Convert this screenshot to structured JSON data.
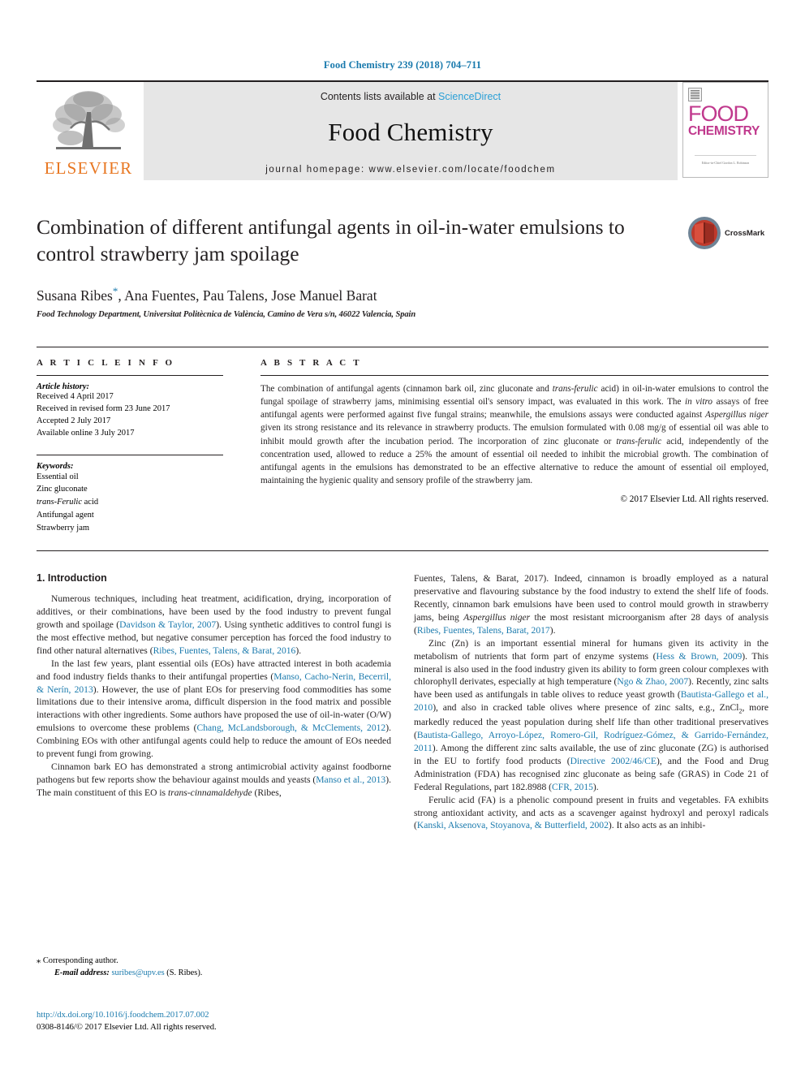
{
  "running_head": "Food Chemistry 239 (2018) 704–711",
  "masthead": {
    "publisher_name": "ELSEVIER",
    "contents_prefix": "Contents lists available at ",
    "sciencedirect": "ScienceDirect",
    "journal_title": "Food Chemistry",
    "homepage": "journal homepage: www.elsevier.com/locate/foodchem",
    "cover": {
      "food": "FOOD",
      "chemistry": "CHEMISTRY",
      "footline": "Editor-in-Chief\nGordon L. Robinson"
    }
  },
  "title": "Combination of different antifungal agents in oil-in-water emulsions to control strawberry jam spoilage",
  "authors": "Susana Ribes",
  "authors_rest": ", Ana Fuentes, Pau Talens, Jose Manuel Barat",
  "corresponding_star": "*",
  "affiliation": "Food Technology Department, Universitat Politècnica de València, Camino de Vera s/n, 46022 Valencia, Spain",
  "crossmark_label": "CrossMark",
  "article_info": {
    "heading": "A R T I C L E   I N F O",
    "history_label": "Article history:",
    "history": [
      "Received 4 April 2017",
      "Received in revised form 23 June 2017",
      "Accepted 2 July 2017",
      "Available online 3 July 2017"
    ],
    "keywords_label": "Keywords:",
    "keywords": [
      "Essential oil",
      "Zinc gluconate",
      "trans-Ferulic acid",
      "Antifungal agent",
      "Strawberry jam"
    ]
  },
  "abstract": {
    "heading": "A B S T R A C T",
    "text": "The combination of antifungal agents (cinnamon bark oil, zinc gluconate and trans-ferulic acid) in oil-in-water emulsions to control the fungal spoilage of strawberry jams, minimising essential oil's sensory impact, was evaluated in this work. The in vitro assays of free antifungal agents were performed against five fungal strains; meanwhile, the emulsions assays were conducted against Aspergillus niger given its strong resistance and its relevance in strawberry products. The emulsion formulated with 0.08 mg/g of essential oil was able to inhibit mould growth after the incubation period. The incorporation of zinc gluconate or trans-ferulic acid, independently of the concentration used, allowed to reduce a 25% the amount of essential oil needed to inhibit the microbial growth. The combination of antifungal agents in the emulsions has demonstrated to be an effective alternative to reduce the amount of essential oil employed, maintaining the hygienic quality and sensory profile of the strawberry jam.",
    "copyright": "© 2017 Elsevier Ltd. All rights reserved."
  },
  "introduction": {
    "heading": "1. Introduction",
    "left_paragraphs": [
      "Numerous techniques, including heat treatment, acidification, drying, incorporation of additives, or their combinations, have been used by the food industry to prevent fungal growth and spoilage (Davidson & Taylor, 2007). Using synthetic additives to control fungi is the most effective method, but negative consumer perception has forced the food industry to find other natural alternatives (Ribes, Fuentes, Talens, & Barat, 2016).",
      "In the last few years, plant essential oils (EOs) have attracted interest in both academia and food industry fields thanks to their antifungal properties (Manso, Cacho-Nerin, Becerril, & Nerín, 2013). However, the use of plant EOs for preserving food commodities has some limitations due to their intensive aroma, difficult dispersion in the food matrix and possible interactions with other ingredients. Some authors have proposed the use of oil-in-water (O/W) emulsions to overcome these problems (Chang, McLandsborough, & McClements, 2012). Combining EOs with other antifungal agents could help to reduce the amount of EOs needed to prevent fungi from growing.",
      "Cinnamon bark EO has demonstrated a strong antimicrobial activity against foodborne pathogens but few reports show the behaviour against moulds and yeasts (Manso et al., 2013). The main constituent of this EO is trans-cinnamaldehyde (Ribes,"
    ],
    "right_paragraphs": [
      "Fuentes, Talens, & Barat, 2017). Indeed, cinnamon is broadly employed as a natural preservative and flavouring substance by the food industry to extend the shelf life of foods. Recently, cinnamon bark emulsions have been used to control mould growth in strawberry jams, being Aspergillus niger the most resistant microorganism after 28 days of analysis (Ribes, Fuentes, Talens, Barat, 2017).",
      "Zinc (Zn) is an important essential mineral for humans given its activity in the metabolism of nutrients that form part of enzyme systems (Hess & Brown, 2009). This mineral is also used in the food industry given its ability to form green colour complexes with chlorophyll derivates, especially at high temperature (Ngo & Zhao, 2007). Recently, zinc salts have been used as antifungals in table olives to reduce yeast growth (Bautista-Gallego et al., 2010), and also in cracked table olives where presence of zinc salts, e.g., ZnCl2, more markedly reduced the yeast population during shelf life than other traditional preservatives (Bautista-Gallego, Arroyo-López, Romero-Gil, Rodríguez-Gómez, & Garrido-Fernández, 2011). Among the different zinc salts available, the use of zinc gluconate (ZG) is authorised in the EU to fortify food products (Directive 2002/46/CE), and the Food and Drug Administration (FDA) has recognised zinc gluconate as being safe (GRAS) in Code 21 of Federal Regulations, part 182.8988 (CFR, 2015).",
      "Ferulic acid (FA) is a phenolic compound present in fruits and vegetables. FA exhibits strong antioxidant activity, and acts as a scavenger against hydroxyl and peroxyl radicals (Kanski, Aksenova, Stoyanova, & Butterfield, 2002). It also acts as an inhibi-"
    ]
  },
  "footnote": {
    "corresponding": "Corresponding author.",
    "email_label": "E-mail address:",
    "email": "suribes@upv.es",
    "email_suffix": "(S. Ribes)."
  },
  "doi": {
    "url": "http://dx.doi.org/10.1016/j.foodchem.2017.07.002",
    "issn_line": "0308-8146/© 2017 Elsevier Ltd. All rights reserved."
  },
  "colors": {
    "link": "#1a7aad",
    "elsevier_orange": "#E87722",
    "cover_magenta": "#c0398d",
    "sciencedirect_blue": "#2a9fd6"
  }
}
